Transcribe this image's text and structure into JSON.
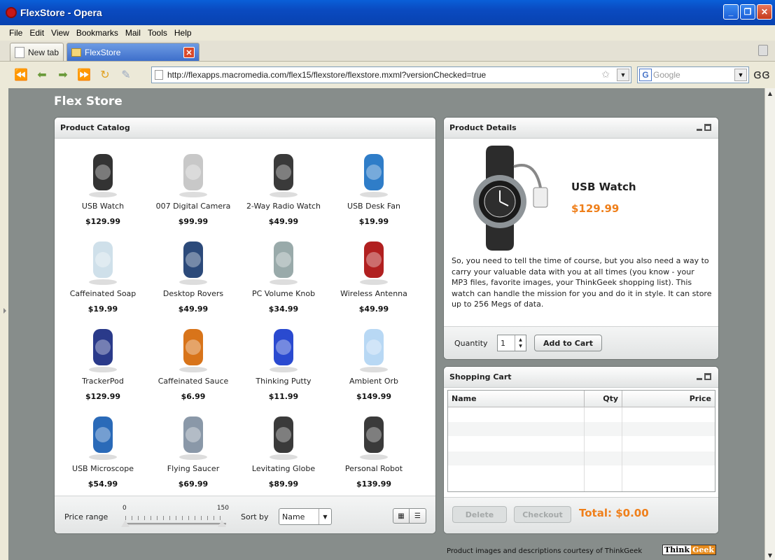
{
  "window": {
    "title": "FlexStore - Opera"
  },
  "menu": [
    "File",
    "Edit",
    "View",
    "Bookmarks",
    "Mail",
    "Tools",
    "Help"
  ],
  "tabs": [
    {
      "label": "New tab"
    },
    {
      "label": "FlexStore"
    }
  ],
  "address": {
    "url": "http://flexapps.macromedia.com/flex15/flexstore/flexstore.mxml?versionChecked=true"
  },
  "search": {
    "placeholder": "Google"
  },
  "app": {
    "title": "Flex Store"
  },
  "catalog": {
    "title": "Product Catalog",
    "items": [
      {
        "name": "USB Watch",
        "price": "$129.99"
      },
      {
        "name": "007 Digital Camera",
        "price": "$99.99"
      },
      {
        "name": "2-Way Radio Watch",
        "price": "$49.99"
      },
      {
        "name": "USB Desk Fan",
        "price": "$19.99"
      },
      {
        "name": "Caffeinated Soap",
        "price": "$19.99"
      },
      {
        "name": "Desktop Rovers",
        "price": "$49.99"
      },
      {
        "name": "PC Volume Knob",
        "price": "$34.99"
      },
      {
        "name": "Wireless Antenna",
        "price": "$49.99"
      },
      {
        "name": "TrackerPod",
        "price": "$129.99"
      },
      {
        "name": "Caffeinated Sauce",
        "price": "$6.99"
      },
      {
        "name": "Thinking Putty",
        "price": "$11.99"
      },
      {
        "name": "Ambient Orb",
        "price": "$149.99"
      },
      {
        "name": "USB Microscope",
        "price": "$54.99"
      },
      {
        "name": "Flying Saucer",
        "price": "$69.99"
      },
      {
        "name": "Levitating Globe",
        "price": "$89.99"
      },
      {
        "name": "Personal Robot",
        "price": "$139.99"
      }
    ],
    "footer": {
      "price_range_label": "Price range",
      "slider_min": "0",
      "slider_max": "150",
      "sort_label": "Sort by",
      "sort_value": "Name"
    }
  },
  "details": {
    "title": "Product Details",
    "name": "USB Watch",
    "price": "$129.99",
    "description": "So, you need to tell the time of course, but you also need a way to carry your valuable data with you at all times (you know - your MP3 files, favorite images, your ThinkGeek shopping list). This watch can handle the mission for you and do it in style. It can store up to 256 Megs of data.",
    "quantity_label": "Quantity",
    "quantity": "1",
    "add_button": "Add to Cart"
  },
  "cart": {
    "title": "Shopping Cart",
    "columns": [
      "Name",
      "Qty",
      "Price"
    ],
    "delete_button": "Delete",
    "checkout_button": "Checkout",
    "total": "Total: $0.00"
  },
  "credit": {
    "text": "Product images and descriptions courtesy of ThinkGeek",
    "logo_a": "Think",
    "logo_b": "Geek"
  },
  "colors": {
    "accent": "#ef7f1a",
    "background": "#878d8b",
    "titlebar": "#0a4ac0"
  }
}
